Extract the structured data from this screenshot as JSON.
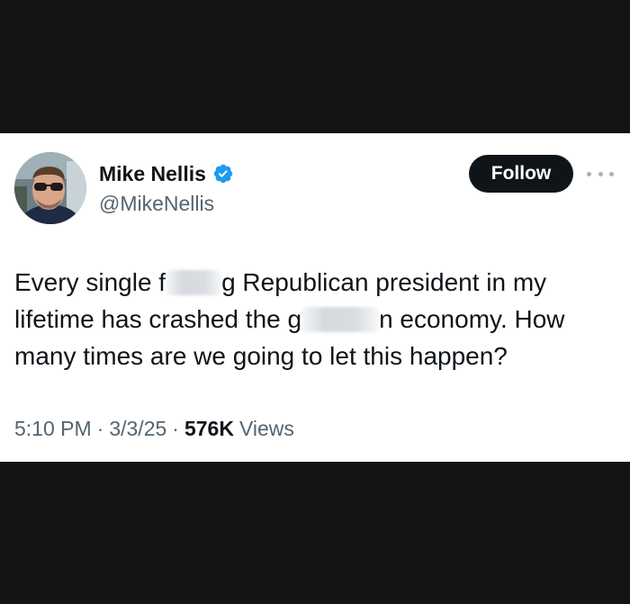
{
  "tweet": {
    "author": {
      "display_name": "Mike Nellis",
      "handle": "@MikeNellis",
      "verified": true,
      "verified_color": "#1d9bf0",
      "avatar_icon": "profile-photo"
    },
    "follow_button": {
      "label": "Follow",
      "background": "#0f1419"
    },
    "more_icon": "more-options-icon",
    "text": {
      "line1_a": "Every single f",
      "line1_b": "g Republican president in my",
      "line2_a": "lifetime has crashed the g",
      "line2_b": "n economy. How",
      "line3": "many times are we going to let this happen?"
    },
    "meta": {
      "time": "5:10 PM",
      "date": "3/3/25",
      "separator": "·",
      "views_count": "576K",
      "views_label": "Views"
    }
  },
  "colors": {
    "page_background": "#141414",
    "card_background": "#ffffff",
    "primary_text": "#0f1419",
    "secondary_text": "#536471"
  }
}
